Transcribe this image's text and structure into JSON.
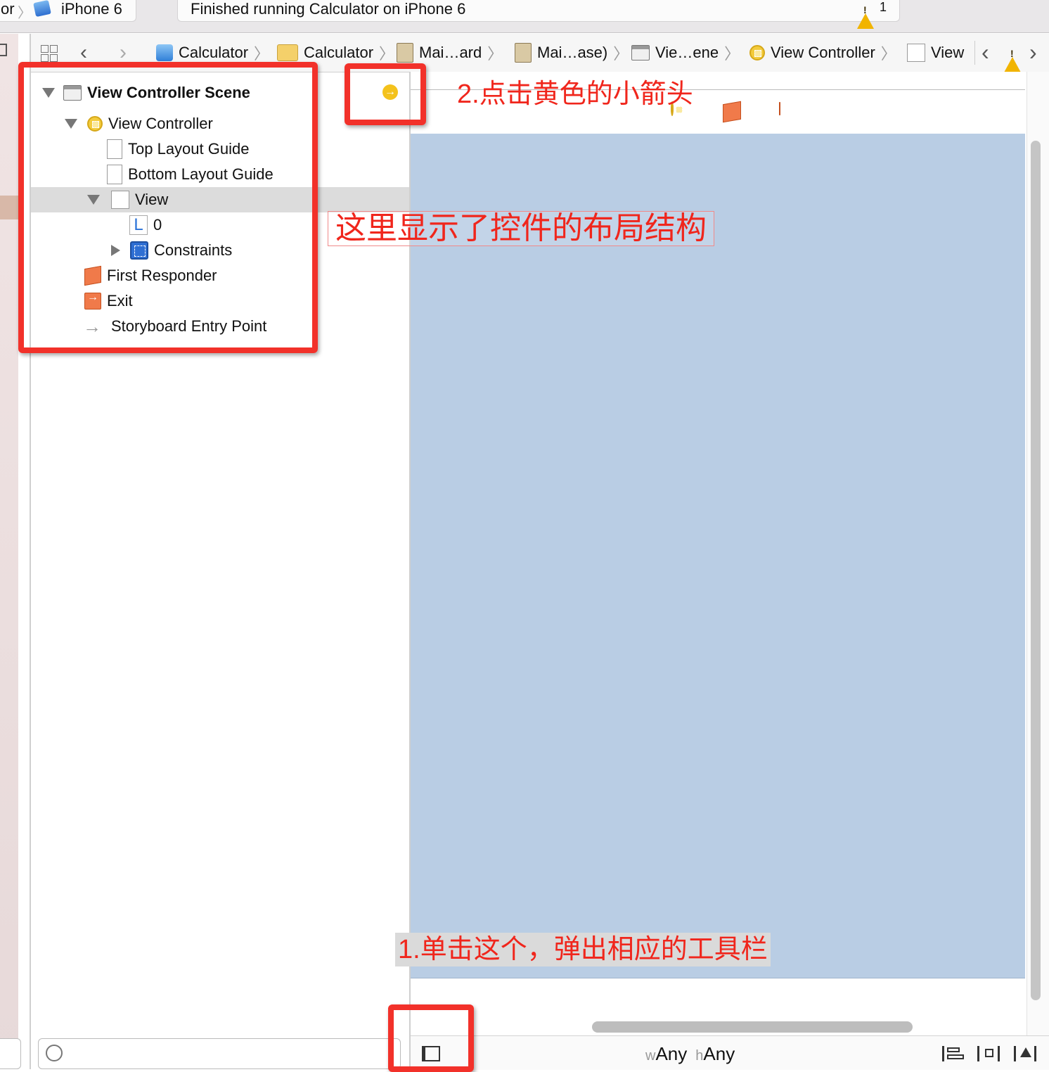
{
  "topbar": {
    "scheme_fragment": "or",
    "device": "iPhone 6",
    "status": "Finished running Calculator on iPhone 6",
    "warning_count": "1"
  },
  "jumpbar": {
    "crumbs": [
      "Calculator",
      "Calculator",
      "Mai…ard",
      "Mai…ase)",
      "Vie…ene",
      "View Controller",
      "View"
    ]
  },
  "outline": {
    "items": [
      {
        "label": "View Controller Scene"
      },
      {
        "label": "View Controller"
      },
      {
        "label": "Top Layout Guide"
      },
      {
        "label": "Bottom Layout Guide"
      },
      {
        "label": "View"
      },
      {
        "label": "0"
      },
      {
        "label": "Constraints"
      },
      {
        "label": "First Responder"
      },
      {
        "label": "Exit"
      },
      {
        "label": "Storyboard Entry Point"
      }
    ],
    "l_glyph": "L"
  },
  "bottombar": {
    "w_prefix": "w",
    "w_value": "Any",
    "h_prefix": "h",
    "h_value": "Any"
  },
  "annotations": {
    "step2": "2.点击黄色的小箭头",
    "layout_note": "这里显示了控件的布局结构",
    "step1": "1.单击这个，弹出相应的工具栏"
  },
  "colors": {
    "annotation_red": "#f2312a",
    "canvas_blue": "#b9cde4",
    "warning_yellow": "#f1b400"
  }
}
